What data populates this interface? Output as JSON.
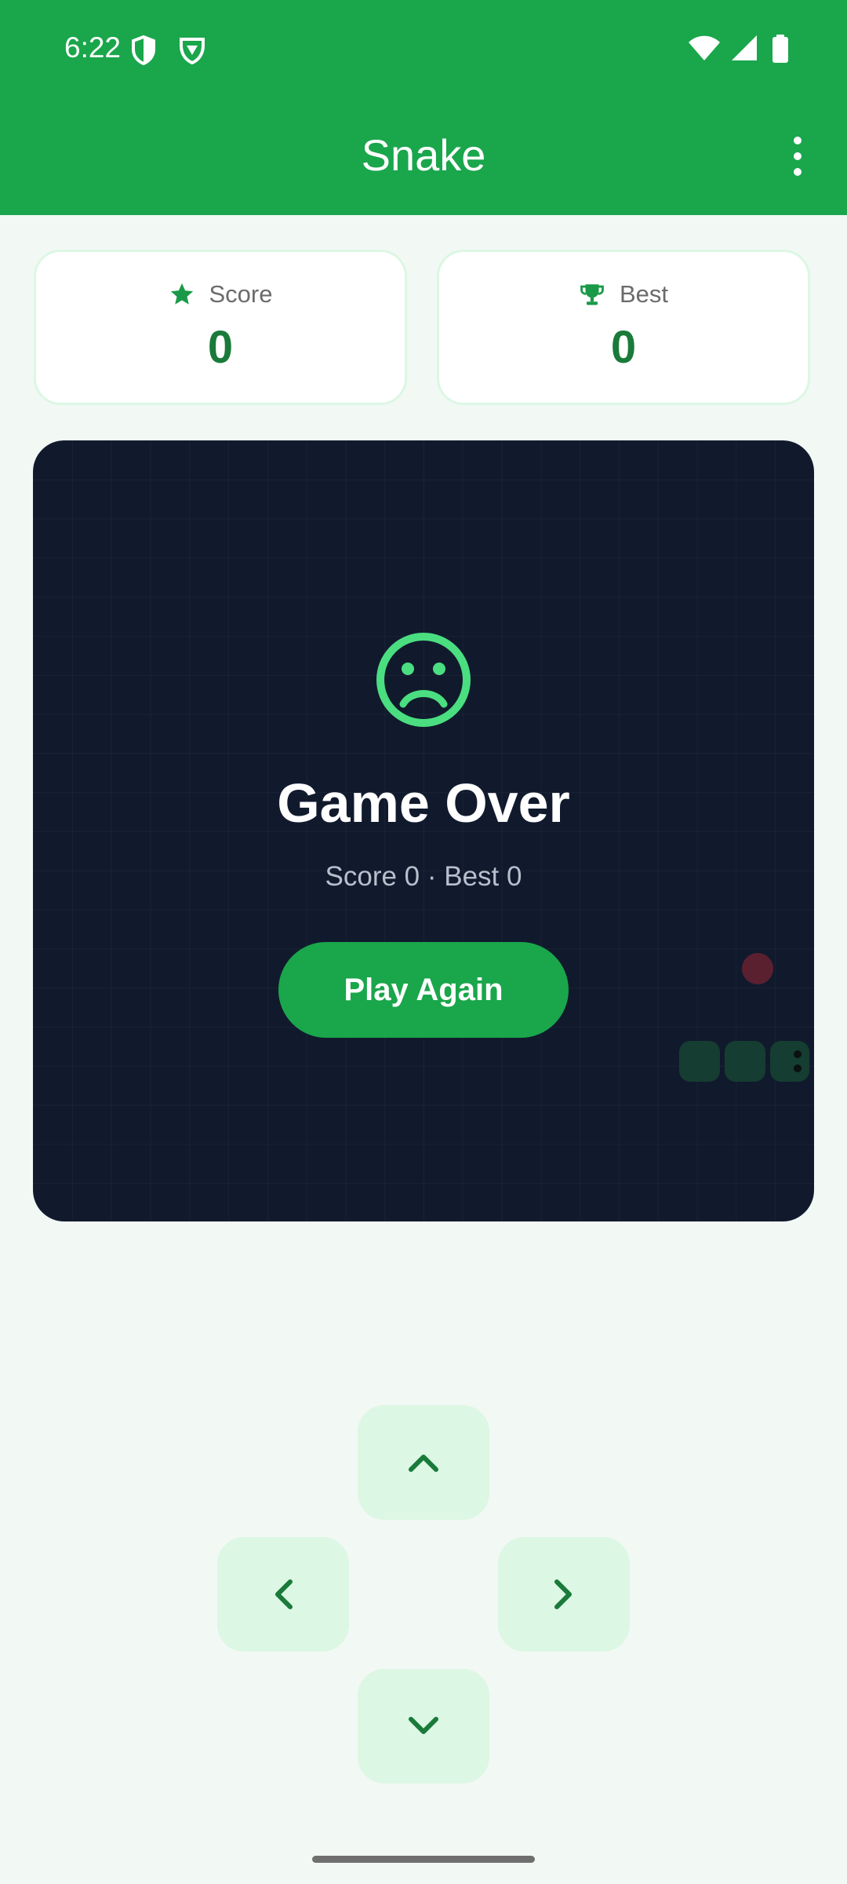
{
  "status_bar": {
    "time": "6:22"
  },
  "app_bar": {
    "title": "Snake",
    "menu_icon": "more-vert-icon"
  },
  "scores": {
    "score": {
      "label": "Score",
      "value": "0",
      "icon": "star-icon"
    },
    "best": {
      "label": "Best",
      "value": "0",
      "icon": "trophy-icon"
    }
  },
  "game_over": {
    "title": "Game Over",
    "subtitle": "Score 0 · Best 0",
    "button_label": "Play Again",
    "icon": "sad-face-icon"
  },
  "controls": [
    "up-arrow-icon",
    "left-arrow-icon",
    "right-arrow-icon",
    "down-arrow-icon"
  ],
  "colors": {
    "primary": "#1aa64b",
    "board": "#111a2d",
    "score_text": "#1a7a3a",
    "button_bg": "#dcf7e4"
  }
}
